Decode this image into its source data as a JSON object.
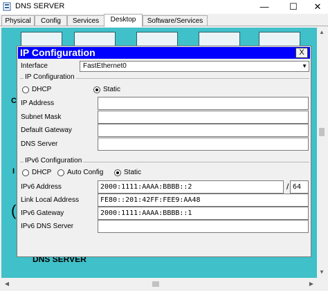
{
  "window": {
    "title": "DNS SERVER",
    "minimize_glyph": "—",
    "maximize_glyph": "☐",
    "close_glyph": "✕"
  },
  "tabs": [
    {
      "label": "Physical"
    },
    {
      "label": "Config"
    },
    {
      "label": "Services"
    },
    {
      "label": "Desktop"
    },
    {
      "label": "Software/Services"
    }
  ],
  "active_tab": "Desktop",
  "desktop": {
    "device_label": "DNS SERVER",
    "left_edge_letters": [
      "C",
      "I",
      "("
    ]
  },
  "dialog": {
    "title": "IP Configuration",
    "close_label": "X",
    "interface_label": "Interface",
    "interface_value": "FastEthernet0",
    "ipv4": {
      "group_title": "IP Configuration",
      "dhcp_label": "DHCP",
      "static_label": "Static",
      "selected_mode": "Static",
      "fields": [
        {
          "label": "IP Address",
          "value": ""
        },
        {
          "label": "Subnet Mask",
          "value": ""
        },
        {
          "label": "Default Gateway",
          "value": ""
        },
        {
          "label": "DNS Server",
          "value": ""
        }
      ]
    },
    "ipv6": {
      "group_title": "IPv6 Configuration",
      "dhcp_label": "DHCP",
      "auto_label": "Auto Config",
      "static_label": "Static",
      "selected_mode": "Static",
      "address_label": "IPv6 Address",
      "address_value": "2000:1111:AAAA:BBBB::2",
      "prefix_separator": "/",
      "prefix_value": "64",
      "link_local_label": "Link Local Address",
      "link_local_value": "FE80::201:42FF:FEE9:AA48",
      "gateway_label": "IPv6 Gateway",
      "gateway_value": "2000:1111:AAAA:BBBB::1",
      "dns_label": "IPv6 DNS Server",
      "dns_value": ""
    }
  },
  "colors": {
    "desktop_bg": "#40c0c8",
    "dialog_title_bg": "#0000ff",
    "dialog_bg": "#f0f0f0"
  },
  "icons": {
    "app": "packet-tracer-icon",
    "dropdown": "chevron-down-icon"
  }
}
